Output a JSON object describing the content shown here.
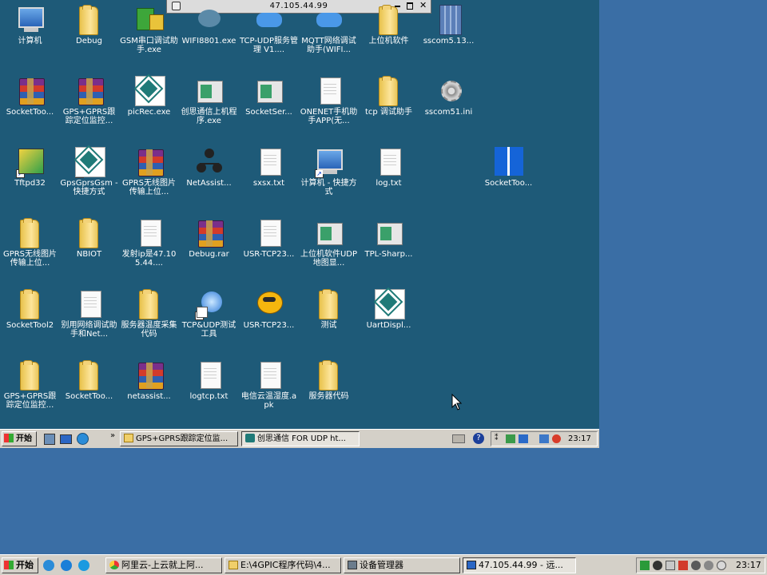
{
  "remote": {
    "connection_bar": {
      "address": "47.105.44.99",
      "icons": [
        "pin-icon",
        "minimize-icon",
        "restore-icon",
        "close-icon"
      ]
    },
    "desktop_icons": [
      {
        "label": "计算机",
        "icon": "computer-icon",
        "shortcut": false
      },
      {
        "label": "Debug",
        "icon": "folder-icon",
        "shortcut": false
      },
      {
        "label": "GSM串口调试助手.exe",
        "icon": "gsm-app-icon",
        "shortcut": false
      },
      {
        "label": "WIFI8801.exe",
        "icon": "wifi-app-icon",
        "shortcut": false
      },
      {
        "label": "TCP-UDP服务管理 V1....",
        "icon": "tcp-udp-app-icon",
        "shortcut": false
      },
      {
        "label": "MQTT网络调试助手(WIFI...",
        "icon": "mqtt-app-icon",
        "shortcut": false
      },
      {
        "label": "上位机软件",
        "icon": "folder-icon",
        "shortcut": false
      },
      {
        "label": "sscom5.13...",
        "icon": "sscom-app-icon",
        "shortcut": false
      },
      {
        "label": "SocketToo...",
        "icon": "rar-icon",
        "shortcut": false
      },
      {
        "label": "GPS+GPRS跟踪定位监控...",
        "icon": "rar-icon",
        "shortcut": false
      },
      {
        "label": "picRec.exe",
        "icon": "green-diamond-app-icon",
        "shortcut": false
      },
      {
        "label": "创思通信上机程序.exe",
        "icon": "exe-window-icon",
        "shortcut": false
      },
      {
        "label": "SocketSer...",
        "icon": "exe-window-icon",
        "shortcut": false
      },
      {
        "label": "ONENET手机助手APP(无...",
        "icon": "document-icon",
        "shortcut": false
      },
      {
        "label": "tcp 调试助手",
        "icon": "folder-icon",
        "shortcut": false
      },
      {
        "label": "sscom51.ini",
        "icon": "settings-file-icon",
        "shortcut": false
      },
      {
        "label": "Tftpd32",
        "icon": "tftp-app-icon",
        "shortcut": true
      },
      {
        "label": "GpsGprsGsm - 快捷方式",
        "icon": "green-diamond-app-icon",
        "shortcut": true
      },
      {
        "label": "GPRS无线图片传输上位...",
        "icon": "rar-icon",
        "shortcut": false
      },
      {
        "label": "NetAssist...",
        "icon": "network-app-icon",
        "shortcut": false
      },
      {
        "label": "sxsx.txt",
        "icon": "document-icon",
        "shortcut": false
      },
      {
        "label": "计算机 - 快捷方式",
        "icon": "computer-icon",
        "shortcut": true
      },
      {
        "label": "log.txt",
        "icon": "document-icon",
        "shortcut": false
      },
      {
        "label": "SocketToo...",
        "icon": "windows-app-icon",
        "shortcut": false
      },
      {
        "label": "GPRS无线图片传输上位...",
        "icon": "folder-icon",
        "shortcut": false
      },
      {
        "label": "NBIOT",
        "icon": "folder-icon",
        "shortcut": false
      },
      {
        "label": "发射ip是47.105.44....",
        "icon": "document-icon",
        "shortcut": false
      },
      {
        "label": "Debug.rar",
        "icon": "rar-icon",
        "shortcut": false
      },
      {
        "label": "USR-TCP23...",
        "icon": "document-icon",
        "shortcut": false
      },
      {
        "label": "上位机软件UDP地图显...",
        "icon": "exe-window-icon",
        "shortcut": false
      },
      {
        "label": "TPL-Sharp...",
        "icon": "exe-window-icon",
        "shortcut": false
      },
      {
        "label": "SocketTool2",
        "icon": "folder-icon",
        "shortcut": false
      },
      {
        "label": "别用网络调试助手和Net...",
        "icon": "document-icon",
        "shortcut": false
      },
      {
        "label": "服务器温度采集代码",
        "icon": "folder-icon",
        "shortcut": false
      },
      {
        "label": "TCP&UDP测试工具",
        "icon": "ie-app-icon",
        "shortcut": true
      },
      {
        "label": "USR-TCP23...",
        "icon": "face-app-icon",
        "shortcut": false
      },
      {
        "label": "测试",
        "icon": "folder-icon",
        "shortcut": false
      },
      {
        "label": "UartDispl...",
        "icon": "green-diamond-app-icon",
        "shortcut": false
      },
      {
        "label": "GPS+GPRS跟踪定位监控...",
        "icon": "folder-icon",
        "shortcut": false
      },
      {
        "label": "SocketToo...",
        "icon": "folder-icon",
        "shortcut": false
      },
      {
        "label": "netassist...",
        "icon": "rar-icon",
        "shortcut": false
      },
      {
        "label": "logtcp.txt",
        "icon": "document-icon",
        "shortcut": false
      },
      {
        "label": "电信云温湿度.apk",
        "icon": "document-icon",
        "shortcut": false
      },
      {
        "label": "服务器代码",
        "icon": "folder-icon",
        "shortcut": false
      }
    ],
    "taskbar": {
      "start_label": "开始",
      "quick_launch": [
        "server-manager-icon",
        "show-desktop-icon",
        "ie-icon"
      ],
      "tasks": [
        {
          "label": "GPS+GPRS跟踪定位监...",
          "icon": "folder-icon",
          "active": false
        },
        {
          "label": "创思通信 FOR UDP ht...",
          "icon": "app-icon",
          "active": true
        }
      ],
      "clock": "23:17"
    }
  },
  "host_taskbar": {
    "start_label": "开始",
    "quick_launch": [
      "ie-icon",
      "qq-icon",
      "edge-icon"
    ],
    "tasks": [
      {
        "label": "阿里云-上云就上阿...",
        "icon": "chrome-icon",
        "active": false
      },
      {
        "label": "E:\\4GPIC程序代码\\4...",
        "icon": "folder-icon",
        "active": false
      },
      {
        "label": "设备管理器",
        "icon": "device-manager-icon",
        "active": false
      },
      {
        "label": "47.105.44.99 - 远...",
        "icon": "remote-desktop-icon",
        "active": true
      }
    ],
    "clock": "23:17"
  }
}
